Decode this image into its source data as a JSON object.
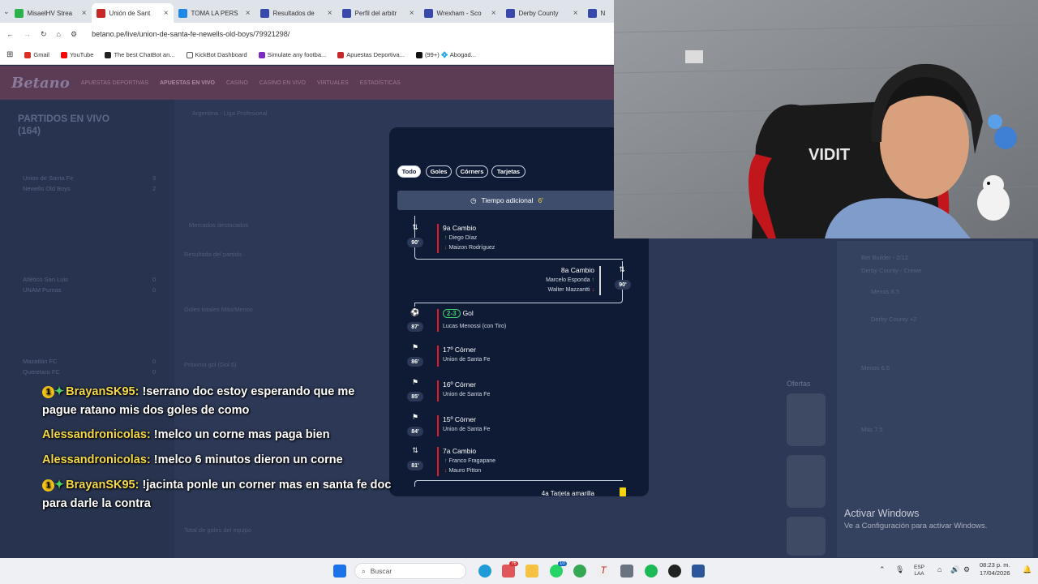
{
  "browser": {
    "tabs": [
      {
        "label": "MisaelHV Strea",
        "color": "#2bb24c",
        "active": false
      },
      {
        "label": "Unión de Sant",
        "color": "#c62828",
        "active": true
      },
      {
        "label": "TOMA LA PERS",
        "color": "#1e88e5",
        "active": false
      },
      {
        "label": "Resultados de",
        "color": "#3949ab",
        "active": false
      },
      {
        "label": "Perfil del arbitr",
        "color": "#3949ab",
        "active": false
      },
      {
        "label": "Wrexham - Sco",
        "color": "#3949ab",
        "active": false
      },
      {
        "label": "Derby County",
        "color": "#3949ab",
        "active": false
      },
      {
        "label": "N",
        "color": "#3949ab",
        "active": false
      }
    ],
    "url": "betano.pe/live/union-de-santa-fe-newells-old-boys/79921298/",
    "bookmarks": [
      {
        "label": "Gmail",
        "color": "#d93025"
      },
      {
        "label": "YouTube",
        "color": "#ff0000"
      },
      {
        "label": "The best ChatBot an...",
        "color": "#222222"
      },
      {
        "label": "KickBot Dashboard",
        "color": "#ffffff"
      },
      {
        "label": "Simulate any footba...",
        "color": "#7b2cbf"
      },
      {
        "label": "Apuestas Deportiva...",
        "color": "#c62828"
      },
      {
        "label": "(99+) 💠 Abogad...",
        "color": "#111111"
      }
    ]
  },
  "site": {
    "logo": "Betano",
    "nav": [
      "APUESTAS DEPORTIVAS",
      "APUESTAS EN VIVO",
      "CASINO",
      "CASINO EN VIVO",
      "VIRTUALES",
      "ESTADÍSTICAS"
    ],
    "live_title": "PARTIDOS EN VIVO",
    "live_count": "(164)",
    "left_rows": [
      {
        "team": "Union de Santa Fe",
        "score": "3"
      },
      {
        "team": "Newells Old Boys",
        "score": "2"
      },
      {
        "team": "Atlético San Luis",
        "score": "0"
      },
      {
        "team": "UNAM Pumas",
        "score": "0"
      },
      {
        "team": "Mazatlán FC",
        "score": "0"
      },
      {
        "team": "Queretaro FC",
        "score": "0"
      }
    ],
    "center_lines": [
      "Argentina - Liga Profesional",
      "Mercados destacados",
      "Resultado del partido",
      "Goles totales Más/Menos",
      "Próximo gol (Gol 6)",
      "Total de goles del equipo"
    ],
    "offers": "Ofertas",
    "betslip_lines": [
      "Bet Builder - 2/12",
      "Derby County - Crewe",
      "Menos 6.5",
      "Derby County +2",
      "Menos 6.5",
      "Más 7.5"
    ]
  },
  "timeline": {
    "filters": [
      "Todo",
      "Goles",
      "Córners",
      "Tarjetas"
    ],
    "added_time_label": "Tiempo adicional",
    "added_time_value": "6'",
    "events": [
      {
        "minute": "90'",
        "title": "9a Cambio",
        "in": "Diego Díaz",
        "out": "Maizon Rodríguez"
      },
      {
        "minute": "90'",
        "title": "8a Cambio",
        "in": "Marcelo Esponda",
        "out": "Walter Mazzantti"
      },
      {
        "minute": "87'",
        "score": "2-3",
        "title": "Gol",
        "detail": "Lucas Menossi (con Tiro)"
      },
      {
        "minute": "86'",
        "title": "17º Córner",
        "detail": "Union de Santa Fe"
      },
      {
        "minute": "85'",
        "title": "16º Córner",
        "detail": "Union de Santa Fe"
      },
      {
        "minute": "84'",
        "title": "15º Córner",
        "detail": "Union de Santa Fe"
      },
      {
        "minute": "81'",
        "title": "7a Cambio",
        "in": "Franco Fragapane",
        "out": "Mauro Pitton"
      },
      {
        "title": "4a Tarjeta amarilla"
      }
    ]
  },
  "chat": [
    {
      "badge": "1",
      "user": "BrayanSK95:",
      "msg": "!serrano doc estoy esperando que me",
      "cont": "pague ratano mis dos goles de como"
    },
    {
      "user": "Alessandronicolas:",
      "msg": "!melco un corne mas paga bien"
    },
    {
      "user": "Alessandronicolas:",
      "msg": "!melco 6 minutos dieron un corne"
    },
    {
      "badge": "1",
      "user": "BrayanSK95:",
      "msg": "!jacinta ponle un corner mas en santa fe doc",
      "cont": "para darle la contra"
    }
  ],
  "watermark": {
    "line1": "Activar Windows",
    "line2": "Ve a Configuración para activar Windows."
  },
  "taskbar": {
    "search_placeholder": "Buscar",
    "lang": "ESP",
    "lang2": "LAA",
    "time": "08:23 p. m.",
    "date": "17/04/2026",
    "mail_badge": "76",
    "whatsapp_badge": "10"
  }
}
